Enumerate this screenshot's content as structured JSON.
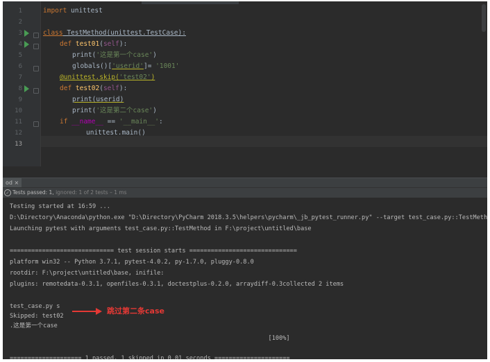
{
  "editor": {
    "line_numbers": [
      "1",
      "2",
      "3",
      "4",
      "5",
      "6",
      "7",
      "8",
      "9",
      "10",
      "11",
      "12",
      "13"
    ],
    "code": {
      "import_kw": "import",
      "import_mod": " unittest",
      "class_kw": "class",
      "class_sig": " TestMethod(unittest.TestCase):",
      "def1_kw": "def",
      "def1_name": " test01",
      "def1_open": "(",
      "def1_self": "self",
      "def1_close": "):",
      "print1_fn": "print(",
      "print1_str": "'这是第一个case'",
      "print1_close": ")",
      "globals_call": "globals()[",
      "globals_key": "'userid'",
      "globals_eq": "]= ",
      "globals_val": "'1001'",
      "decorator": "@unittest.skip(",
      "decorator_arg": "'test02'",
      "decorator_close": ")",
      "def2_kw": "def",
      "def2_name": " test02",
      "def2_open": "(",
      "def2_self": "self",
      "def2_close": "):",
      "print2_text": "print(userid)",
      "print3_fn": "print(",
      "print3_str": "'这是第二个case'",
      "print3_close": ")",
      "if_kw": "if",
      "if_name": " __name__",
      "if_eq": " == ",
      "if_str": "'__main__'",
      "if_colon": ":",
      "main_call": "unittest.main()"
    }
  },
  "run_panel": {
    "tab_label": "od ×",
    "status_passed": "Tests passed: 1, ",
    "status_ignored": "ignored: 1 of 2 tests – 1 ms",
    "check_icon": "check-circle-icon"
  },
  "console": {
    "lines": [
      "Testing started at 16:59 ...",
      "D:\\Directory\\Anaconda\\python.exe \"D:\\Directory\\PyCharm 2018.3.5\\helpers\\pycharm\\_jb_pytest_runner.py\" --target test_case.py::TestMethod",
      "Launching pytest with arguments test_case.py::TestMethod in F:\\project\\untitled\\base",
      "",
      "============================= test session starts ==============================",
      "platform win32 -- Python 3.7.1, pytest-4.0.2, py-1.7.0, pluggy-0.8.0",
      "rootdir: F:\\project\\untitled\\base, inifile:",
      "plugins: remotedata-0.3.1, openfiles-0.3.1, doctestplus-0.2.0, arraydiff-0.3collected 2 items",
      "",
      "test_case.py s",
      "Skipped: test02",
      ".这是第一个case",
      "                                                                        [100%]",
      "",
      "==================== 1 passed, 1 skipped in 0.01 seconds ====================="
    ],
    "annotation": "跳过第二条case",
    "annotation_color": "#e53935"
  }
}
